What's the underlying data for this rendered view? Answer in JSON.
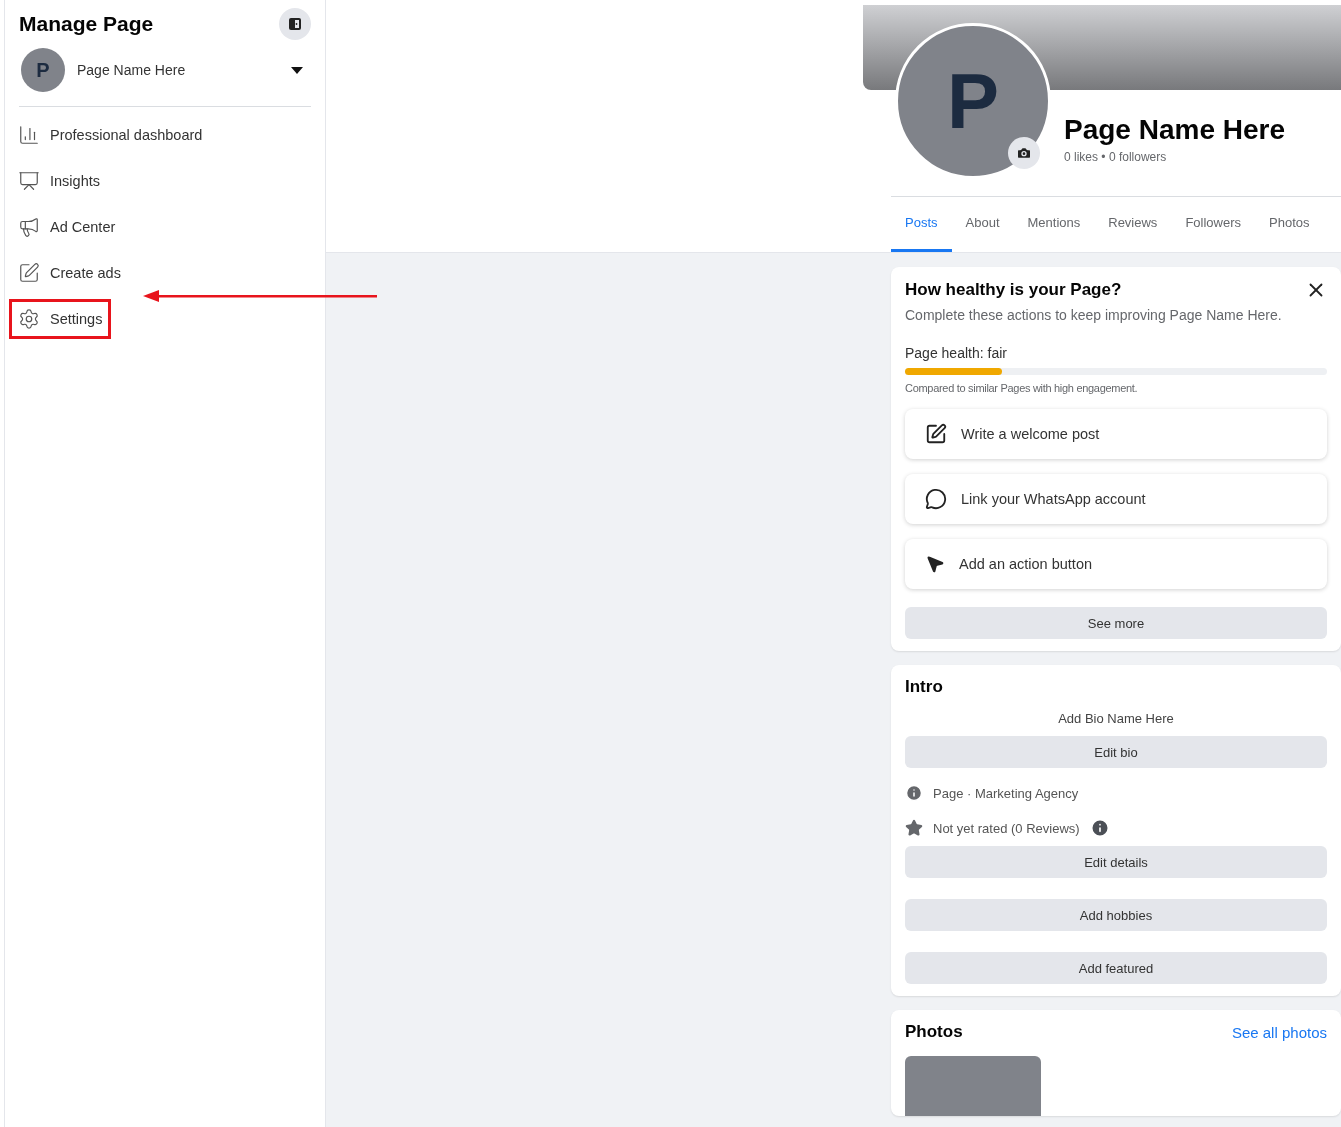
{
  "sidebar": {
    "title": "Manage Page",
    "page_selector": {
      "initial": "P",
      "name": "Page Name Here"
    },
    "items": [
      {
        "kind": "dashboard",
        "label": "Professional dashboard",
        "highlighted": false
      },
      {
        "kind": "insights",
        "label": "Insights",
        "highlighted": false
      },
      {
        "kind": "ads",
        "label": "Ad Center",
        "highlighted": false
      },
      {
        "kind": "create",
        "label": "Create ads",
        "highlighted": false
      },
      {
        "kind": "settings",
        "label": "Settings",
        "highlighted": true
      }
    ]
  },
  "profile": {
    "initial": "P",
    "name": "Page Name Here",
    "stats": "0 likes • 0 followers"
  },
  "tabs": [
    {
      "label": "Posts",
      "selected": true
    },
    {
      "label": "About",
      "selected": false
    },
    {
      "label": "Mentions",
      "selected": false
    },
    {
      "label": "Reviews",
      "selected": false
    },
    {
      "label": "Followers",
      "selected": false
    },
    {
      "label": "Photos",
      "selected": false
    }
  ],
  "health": {
    "title": "How healthy is your Page?",
    "subtitle": "Complete these actions to keep improving Page Name Here.",
    "label": "Page health: fair",
    "level": 0.23,
    "caption": "Compared to similar Pages with high engagement.",
    "actions": [
      {
        "kind": "post",
        "label": "Write a welcome post"
      },
      {
        "kind": "whatsapp",
        "label": "Link your WhatsApp account"
      },
      {
        "kind": "action",
        "label": "Add an action button"
      }
    ],
    "more": "See more"
  },
  "intro": {
    "title": "Intro",
    "bio": "Add Bio Name Here",
    "edit_bio": "Edit bio",
    "category": "Page · Marketing Agency",
    "rating": "Not yet rated (0 Reviews)",
    "buttons": [
      "Edit details",
      "Add hobbies",
      "Add featured"
    ]
  },
  "photos": {
    "title": "Photos",
    "link": "See all photos"
  }
}
